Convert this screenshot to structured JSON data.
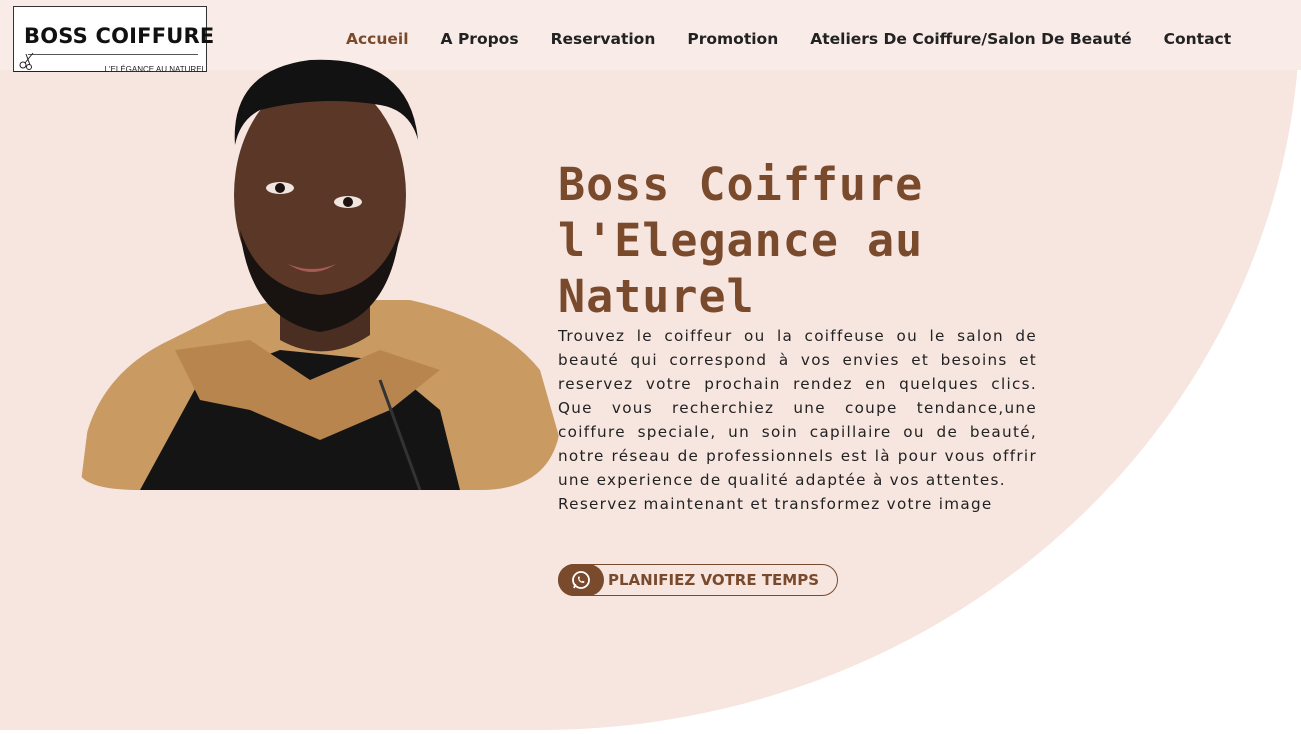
{
  "brand": {
    "name": "BOSS COIFFURE",
    "tagline": "L'ELÉGANCE AU NATUREL"
  },
  "nav": {
    "items": [
      {
        "label": "Accueil",
        "active": true
      },
      {
        "label": "A Propos",
        "active": false
      },
      {
        "label": "Reservation",
        "active": false
      },
      {
        "label": "Promotion",
        "active": false
      },
      {
        "label": "Ateliers De Coiffure/Salon De Beauté",
        "active": false
      },
      {
        "label": "Contact",
        "active": false
      }
    ]
  },
  "hero": {
    "headline": "Boss Coiffure l'Elegance au Naturel",
    "description": "Trouvez le coiffeur ou la coiffeuse ou le salon de beauté qui correspond à vos envies et besoins et reservez votre prochain rendez en quelques clics. Que vous recherchiez une coupe tendance,une coiffure speciale, un soin capillaire ou de beauté, notre réseau de professionnels est là pour vous offrir une experience de qualité adaptée à vos attentes.",
    "description_2": "Reservez maintenant et transformez votre image",
    "cta_label": "PLANIFIEZ VOTRE TEMPS",
    "cta_icon": "whatsapp-icon"
  },
  "colors": {
    "accent": "#7a4a2d",
    "background": "#f7e5df",
    "navbar": "#f9ece8"
  }
}
